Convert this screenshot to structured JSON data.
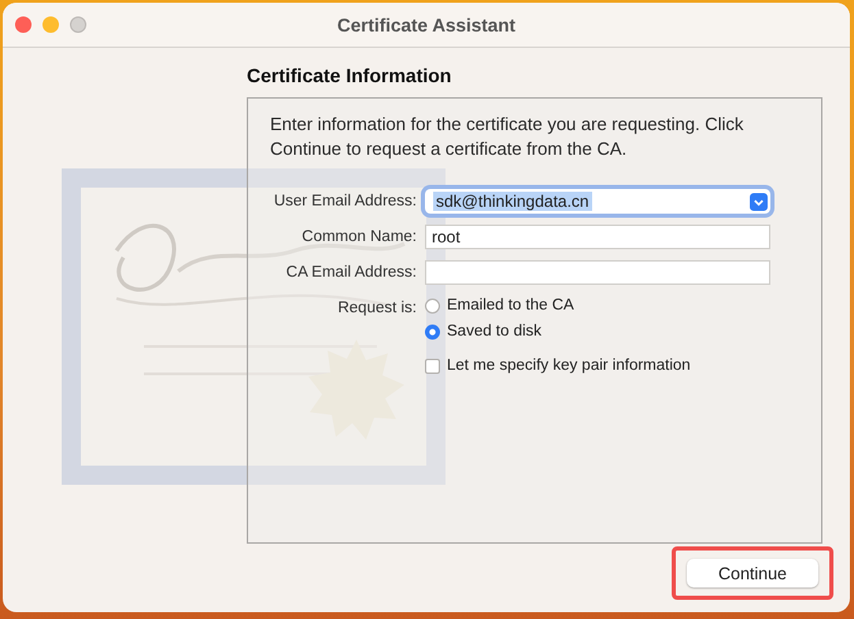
{
  "window": {
    "title": "Certificate Assistant"
  },
  "heading": "Certificate Information",
  "description": "Enter information for the certificate you are requesting. Click Continue to request a certificate from the CA.",
  "fields": [
    {
      "label": "User Email Address:",
      "value": "sdk@thinkingdata.cn",
      "kind": "popup",
      "focused": true
    },
    {
      "label": "Common Name:",
      "value": "root",
      "kind": "text",
      "focused": false
    },
    {
      "label": "CA Email Address:",
      "kind": "text",
      "focused": false
    }
  ],
  "request": {
    "label": "Request is:",
    "options": [
      {
        "label": "Emailed to the CA",
        "selected": false
      },
      {
        "label": "Saved to disk",
        "selected": true
      }
    ]
  },
  "key_pair_checkbox": {
    "label": "Let me specify key pair information",
    "checked": false
  },
  "continue_button": {
    "label": "Continue",
    "highlighted": true
  }
}
